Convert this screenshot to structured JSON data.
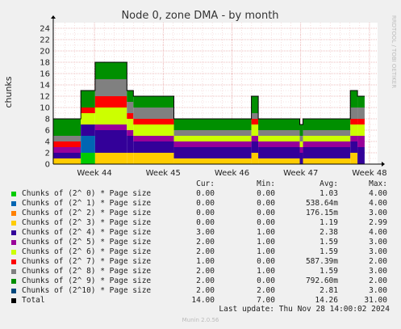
{
  "title": "Node 0, zone DMA - by month",
  "watermark": "RRDTOOL / TOBI OETIKER",
  "footer": "Munin 2.0.56",
  "last_update": "Last update: Thu Nov 28 14:00:02 2024",
  "legend_headers": {
    "cur": "Cur:",
    "min": "Min:",
    "avg": "Avg:",
    "max": "Max:"
  },
  "chart_data": {
    "type": "area",
    "title": "Node 0, zone DMA - by month",
    "ylabel": "chunks",
    "ylim": [
      0,
      25
    ],
    "yticks": [
      0,
      2,
      4,
      6,
      8,
      10,
      12,
      14,
      16,
      18,
      20,
      22,
      24
    ],
    "xticks": [
      "Week 44",
      "Week 45",
      "Week 46",
      "Week 47",
      "Week 48"
    ],
    "grid": true,
    "stacked": true,
    "segments": [
      {
        "from": 0.0,
        "to": 0.085,
        "values": [
          0,
          0,
          0,
          1,
          1,
          1,
          0,
          1,
          1,
          3
        ]
      },
      {
        "from": 0.085,
        "to": 0.129,
        "values": [
          2,
          3,
          0,
          0,
          2,
          0,
          2,
          1,
          0,
          3
        ]
      },
      {
        "from": 0.129,
        "to": 0.227,
        "values": [
          0,
          0,
          0,
          2,
          4,
          1,
          3,
          2,
          3,
          3
        ]
      },
      {
        "from": 0.227,
        "to": 0.247,
        "values": [
          0,
          0,
          0,
          2,
          3,
          1,
          2,
          1,
          2,
          2
        ]
      },
      {
        "from": 0.247,
        "to": 0.372,
        "values": [
          0,
          0,
          0,
          2,
          2,
          1,
          2,
          1,
          2,
          2
        ]
      },
      {
        "from": 0.372,
        "to": 0.611,
        "values": [
          0,
          0,
          0,
          1,
          2,
          1,
          1,
          0,
          1,
          2
        ]
      },
      {
        "from": 0.611,
        "to": 0.632,
        "values": [
          0,
          0,
          0,
          2,
          2,
          1,
          2,
          1,
          1,
          3
        ]
      },
      {
        "from": 0.632,
        "to": 0.76,
        "values": [
          0,
          0,
          0,
          1,
          2,
          1,
          1,
          0,
          1,
          2
        ]
      },
      {
        "from": 0.76,
        "to": 0.77,
        "values": [
          0,
          0,
          0,
          0,
          2,
          1,
          1,
          0,
          1,
          2
        ]
      },
      {
        "from": 0.77,
        "to": 0.916,
        "values": [
          0,
          0,
          0,
          1,
          2,
          1,
          1,
          0,
          1,
          2
        ]
      },
      {
        "from": 0.916,
        "to": 0.938,
        "values": [
          0,
          0,
          0,
          2,
          2,
          1,
          2,
          1,
          2,
          3
        ]
      },
      {
        "from": 0.938,
        "to": 0.96,
        "values": [
          0,
          0,
          0,
          0,
          3,
          2,
          2,
          1,
          2,
          2
        ]
      }
    ],
    "series": [
      {
        "name": "Chunks of (2^ 0) * Page size",
        "color": "#00cc00",
        "cur": "0.00",
        "min": "0.00",
        "avg": "1.03",
        "max": "4.00"
      },
      {
        "name": "Chunks of (2^ 1) * Page size",
        "color": "#0066b3",
        "cur": "0.00",
        "min": "0.00",
        "avg": "538.64m",
        "max": "4.00"
      },
      {
        "name": "Chunks of (2^ 2) * Page size",
        "color": "#ff8000",
        "cur": "0.00",
        "min": "0.00",
        "avg": "176.15m",
        "max": "3.00"
      },
      {
        "name": "Chunks of (2^ 3) * Page size",
        "color": "#ffcc00",
        "cur": "0.00",
        "min": "0.00",
        "avg": "1.19",
        "max": "2.99"
      },
      {
        "name": "Chunks of (2^ 4) * Page size",
        "color": "#330099",
        "cur": "3.00",
        "min": "1.00",
        "avg": "2.38",
        "max": "4.00"
      },
      {
        "name": "Chunks of (2^ 5) * Page size",
        "color": "#990099",
        "cur": "2.00",
        "min": "1.00",
        "avg": "1.59",
        "max": "3.00"
      },
      {
        "name": "Chunks of (2^ 6) * Page size",
        "color": "#ccff00",
        "cur": "2.00",
        "min": "1.00",
        "avg": "1.59",
        "max": "3.00"
      },
      {
        "name": "Chunks of (2^ 7) * Page size",
        "color": "#ff0000",
        "cur": "1.00",
        "min": "0.00",
        "avg": "587.39m",
        "max": "2.00"
      },
      {
        "name": "Chunks of (2^ 8) * Page size",
        "color": "#808080",
        "cur": "2.00",
        "min": "1.00",
        "avg": "1.59",
        "max": "3.00"
      },
      {
        "name": "Chunks of (2^ 9) * Page size",
        "color": "#008f00",
        "cur": "2.00",
        "min": "0.00",
        "avg": "792.60m",
        "max": "2.00"
      },
      {
        "name": "Chunks of (2^10) * Page size",
        "color": "#00487d",
        "cur": "2.00",
        "min": "2.00",
        "avg": "2.81",
        "max": "3.00"
      },
      {
        "name": "Total",
        "color": "#000000",
        "cur": "14.00",
        "min": "7.00",
        "avg": "14.26",
        "max": "31.00"
      }
    ]
  }
}
